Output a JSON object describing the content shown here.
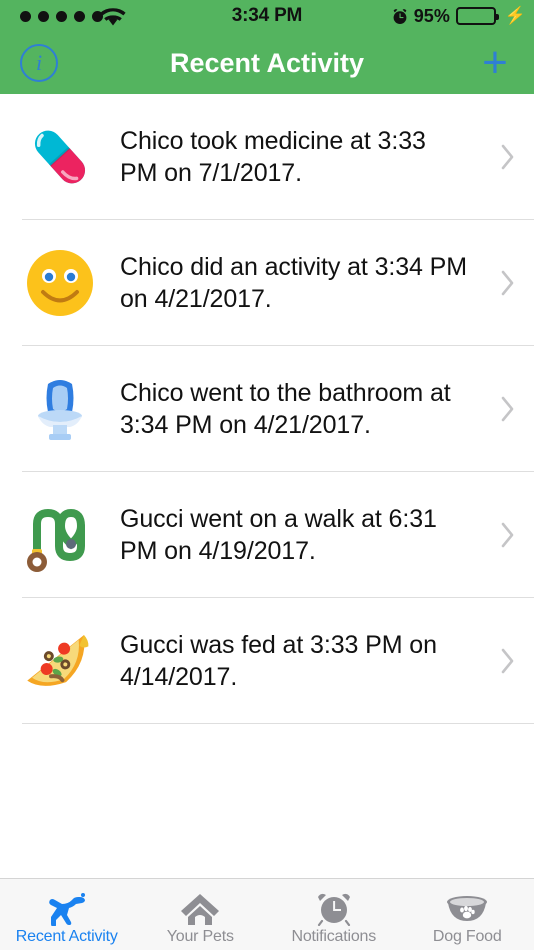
{
  "status_bar": {
    "signal_dots": 5,
    "wifi_icon": "wifi-icon",
    "time": "3:34 PM",
    "alarm_icon": "alarm-clock-icon",
    "battery_percent": "95%",
    "battery_level": 95,
    "charging_icon": "lightning-bolt-icon"
  },
  "nav_bar": {
    "title": "Recent Activity",
    "info_icon": "info-icon",
    "info_label": "i",
    "add_icon": "plus-icon",
    "add_label": "+",
    "background_color": "#54b45f",
    "tint_color": "#2f7fd4",
    "title_color": "#ffffff"
  },
  "activity_list": {
    "rows": [
      {
        "icon": "pill-emoji",
        "text": "Chico took medicine at 3:33 PM on 7/1/2017.",
        "pet": "Chico",
        "event": "took medicine",
        "time": "3:33 PM",
        "date": "7/1/2017",
        "chevron": "chevron-right-icon"
      },
      {
        "icon": "smiley-face-emoji",
        "text": "Chico did an activity at 3:34 PM on 4/21/2017.",
        "pet": "Chico",
        "event": "did an activity",
        "time": "3:34 PM",
        "date": "4/21/2017",
        "chevron": "chevron-right-icon"
      },
      {
        "icon": "toilet-emoji",
        "text": "Chico went to the bathroom at 3:34 PM on 4/21/2017.",
        "pet": "Chico",
        "event": "went to the bathroom",
        "time": "3:34 PM",
        "date": "4/21/2017",
        "chevron": "chevron-right-icon"
      },
      {
        "icon": "leash-emoji",
        "text": "Gucci went on a walk at 6:31 PM on 4/19/2017.",
        "pet": "Gucci",
        "event": "went on a walk",
        "time": "6:31 PM",
        "date": "4/19/2017",
        "chevron": "chevron-right-icon"
      },
      {
        "icon": "pizza-slice-emoji",
        "text": "Gucci was fed at 3:33 PM on 4/14/2017.",
        "pet": "Gucci",
        "event": "was fed",
        "time": "3:33 PM",
        "date": "4/14/2017",
        "chevron": "chevron-right-icon"
      }
    ],
    "separator_color": "#dedede",
    "text_color": "#121212"
  },
  "tab_bar": {
    "active_index": 0,
    "active_color": "#1a82f0",
    "inactive_color": "#8e8e93",
    "background_color": "#f7f7f7",
    "tabs": [
      {
        "label": "Recent Activity",
        "icon": "running-dog-icon"
      },
      {
        "label": "Your Pets",
        "icon": "dog-house-icon"
      },
      {
        "label": "Notifications",
        "icon": "alarm-clock-icon"
      },
      {
        "label": "Dog Food",
        "icon": "dog-food-bowl-icon"
      }
    ]
  }
}
